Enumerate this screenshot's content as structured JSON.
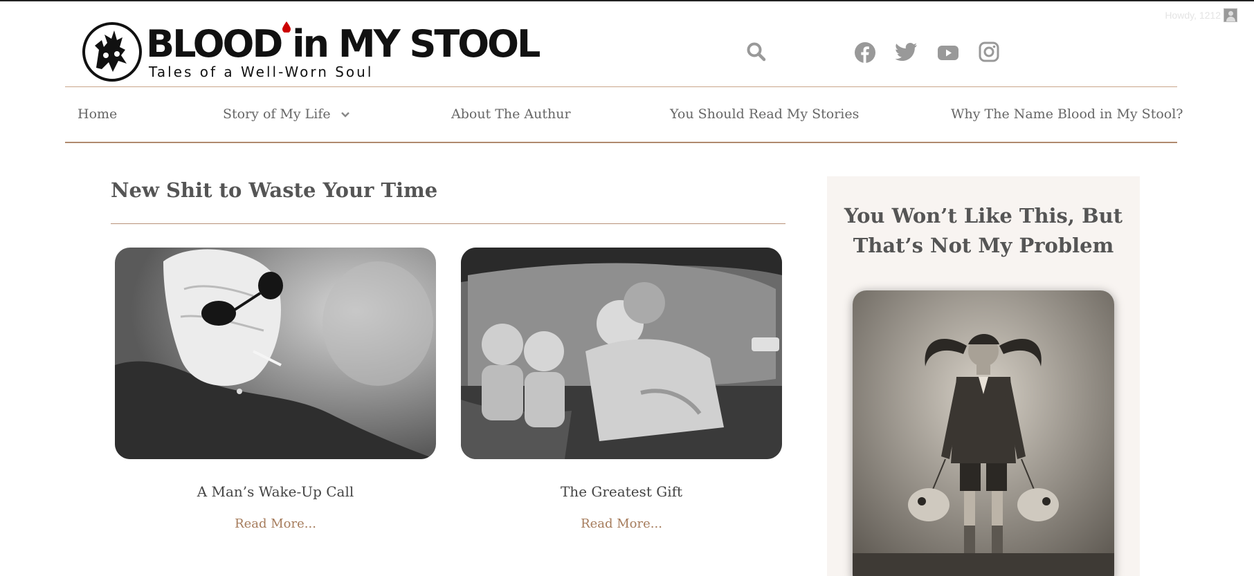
{
  "admin_bar": {
    "greeting": "Howdy, 1212"
  },
  "header": {
    "logo": {
      "title": "BLOOD in MY STOOL",
      "tagline": "Tales of a Well-Worn Soul"
    },
    "icons": [
      "search-icon",
      "facebook-icon",
      "twitter-icon",
      "youtube-icon",
      "instagram-icon"
    ]
  },
  "nav": {
    "items": [
      {
        "label": "Home"
      },
      {
        "label": "Story of My Life",
        "dropdown": true
      },
      {
        "label": "About The Authur"
      },
      {
        "label": "You Should Read My Stories"
      },
      {
        "label": "Why The Name Blood in My Stool?"
      }
    ]
  },
  "main": {
    "section_title": "New Shit to Waste Your Time",
    "posts": [
      {
        "title": "A Man’s Wake-Up Call",
        "read_more": "Read More..."
      },
      {
        "title": "The Greatest Gift",
        "read_more": "Read More..."
      }
    ]
  },
  "sidebar": {
    "title_line1": "You Won’t Like This, But",
    "title_line2": "That’s Not My Problem"
  },
  "colors": {
    "accent": "#a67c5c",
    "rule": "#b89278",
    "sidebar_bg": "#f8f4f1",
    "icon_gray": "#999999",
    "drop_red": "#cc0000"
  }
}
